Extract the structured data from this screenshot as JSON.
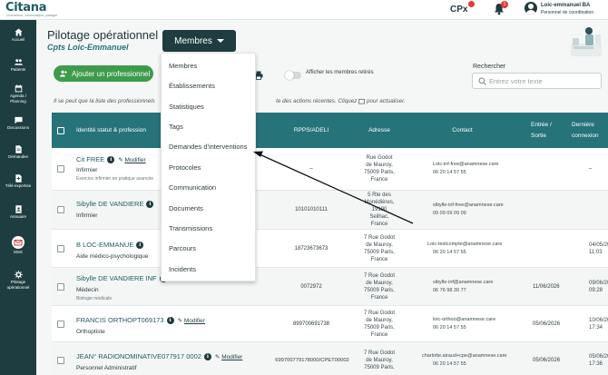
{
  "brand": {
    "name": "Citana",
    "tagline": "Coordonner, communiquer, partager"
  },
  "topbar": {
    "cpx_label": "CPx",
    "notification_count": "1",
    "user_name": "Loic-emmanuel BA",
    "user_role": "Personnel de coordination"
  },
  "sidebar": {
    "items": [
      {
        "label": "Accueil",
        "icon": "home-icon"
      },
      {
        "label": "Patients",
        "icon": "users-icon"
      },
      {
        "label": "Agenda / Planning",
        "icon": "calendar-icon"
      },
      {
        "label": "Discussions",
        "icon": "chat-icon"
      },
      {
        "label": "Demandes",
        "icon": "document-icon"
      },
      {
        "label": "Télé-expertise",
        "icon": "teleexpertise-icon"
      },
      {
        "label": "Annuaire",
        "icon": "directory-icon"
      },
      {
        "label": "MSS",
        "icon": "mss-icon"
      },
      {
        "label": "Pilotage opérationnel",
        "icon": "pilotage-icon"
      }
    ]
  },
  "page": {
    "title": "Pilotage opérationnel",
    "subtitle": "Cpts Loic-Emmanuel"
  },
  "members_button": {
    "label": "Membres"
  },
  "dropdown": {
    "items": [
      "Membres",
      "Établissements",
      "Statistiques",
      "Tags",
      "Demandes d'interventions",
      "Protocoles",
      "Communication",
      "Documents",
      "Transmissions",
      "Parcours",
      "Incidents"
    ]
  },
  "add_button": {
    "label": "Ajouter un professionnel"
  },
  "toggle": {
    "label": "Afficher les membres retirés",
    "enabled": false
  },
  "search": {
    "label": "Rechercher",
    "placeholder": "Entrez votre texte"
  },
  "notice": "Il se peut que la liste des professionnels ne soit pas à jour suite aux actions récentes. Cliquez ici pour actualiser.",
  "notice_visible": "Il se peut que la liste des professionnels",
  "notice_visible_right": "te des actions récentes. Cliquez",
  "notice_visible_end": "pour actualiser.",
  "table": {
    "headers": {
      "identity": "Identité statut & profession",
      "rpps": "RPPS/ADELI",
      "address": "Adresse",
      "contact": "Contact",
      "entry": "Entrée / Sortie",
      "last": "Dernière connexion"
    },
    "modify_label": "Modifier",
    "rows": [
      {
        "name": "Cit FREE",
        "profession": "Infirmier",
        "extra": "Exercice infirmier en pratique avancée",
        "rpps": "–",
        "address": [
          "Rue Godot",
          "de Mauroy,",
          "75009 Paris,",
          "France"
        ],
        "email": "Loic-inf-free@anamnese.care",
        "phone": "06 20 14 57 55",
        "entry": "",
        "last": "–"
      },
      {
        "name": "Sibylle DE VANDIERE",
        "profession": "Infirmier",
        "extra": "",
        "rpps": "10101010111",
        "address": [
          "5 Rte des",
          "Monédières,",
          "19190",
          "Seilhac,",
          "France"
        ],
        "email": "sibylle-inf-free@anamnese.care",
        "phone": "09 09 09 09 09",
        "entry": "",
        "last": ""
      },
      {
        "name": "B LOC-EMMANUE",
        "profession": "Aide médico-psychologique",
        "extra": "",
        "rpps": "18723673673",
        "address": [
          "7 Rue Godot",
          "de Mauroy,",
          "75009 Paris,",
          "France"
        ],
        "email": "Loic-testcompte@anamnese.care",
        "phone": "06 20 14 57 55",
        "entry": "",
        "last": "04/05/202 11:03"
      },
      {
        "name": "Sibylle DE VANDIERE INF",
        "profession": "Médecin",
        "extra": "Biologie médicale",
        "rpps": "0072972",
        "address": [
          "7 Rue Godot",
          "de Mauroy,",
          "75009 Paris,",
          "France"
        ],
        "email": "sibylle-inf@anamnese.care",
        "phone": "06 76 98 30 77",
        "entry": "11/06/2026",
        "last": "09/06/202 09:28"
      },
      {
        "name": "FRANCIS ORTHOPT069173",
        "profession": "Orthoptiste",
        "extra": "",
        "rpps": "899700691738",
        "address": [
          "7 Rue Godot",
          "de Mauroy,",
          "75009 Paris,",
          "France"
        ],
        "email": "loic-orthoo@anamnese.care",
        "phone": "06 20 14 57 55",
        "entry": "05/06/2026",
        "last": "10/06/202 17:34"
      },
      {
        "name": "JEAN° RADIONOMINATIVE077917 0002",
        "profession": "Personnel Administratif",
        "extra": "",
        "rpps": "699700779178000/CPET00002",
        "address": [
          "7 Rue Godot",
          "de Mauroy,",
          "75009 Paris,"
        ],
        "email": "charlotte.airaud+cpe@anamnese.care",
        "phone": "06 20 14 57 55",
        "entry": "05/06/2026",
        "last": "05/06/202 17:36"
      }
    ]
  },
  "colors": {
    "sidebar": "#1e3d40",
    "table_header": "#27737a",
    "primary_button": "#1f3c40",
    "add_button": "#3d9b4b",
    "badge": "#e53935"
  }
}
